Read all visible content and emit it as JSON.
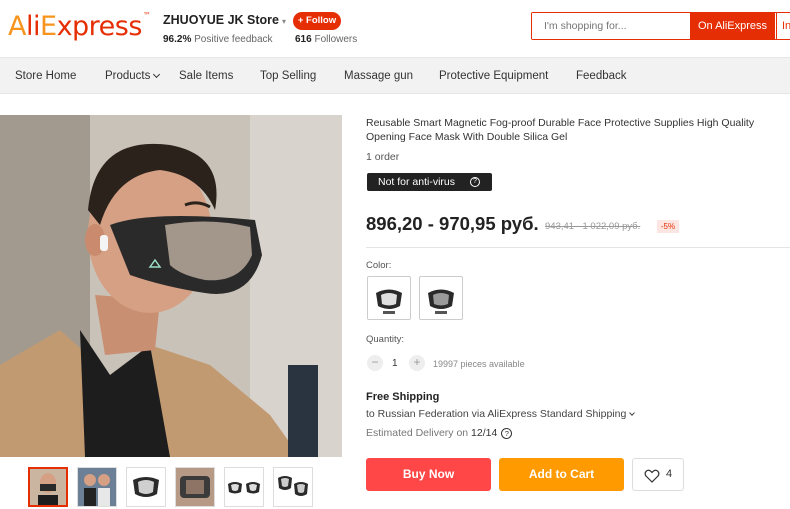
{
  "header": {
    "logo": "AliExpress",
    "store_name": "ZHUOYUE JK Store",
    "feedback_pct": "96.2%",
    "feedback_label": "Positive feedback",
    "follow_label": "+ Follow",
    "followers_count": "616",
    "followers_label": "Followers",
    "search_placeholder": "I'm shopping for...",
    "search_btn_ae": "On AliExpress",
    "search_btn_store": "In"
  },
  "nav": {
    "items": [
      "Store Home",
      "Products",
      "Sale Items",
      "Top Selling",
      "Massage gun",
      "Protective Equipment",
      "Feedback"
    ]
  },
  "product": {
    "title": "Reusable Smart Magnetic Fog-proof Durable Face Protective Supplies High Quality Opening Face Mask With Double Silica Gel",
    "orders": "1 order",
    "badge": "Not for anti-virus",
    "badge_icon": "?",
    "price": "896,20 - 970,95 руб.",
    "old_price": "943,41 - 1 022,09 руб.",
    "discount": "-5%",
    "color_label": "Color:",
    "quantity_label": "Quantity:",
    "qty_minus": "−",
    "qty_value": "1",
    "qty_plus": "+",
    "qty_available": "19997 pieces available",
    "shipping_title": "Free Shipping",
    "shipping_to": "to Russian Federation via AliExpress Standard Shipping",
    "delivery_label": "Estimated Delivery on",
    "delivery_date": "12/14",
    "delivery_icon": "?",
    "buy_now": "Buy Now",
    "add_to_cart": "Add to Cart",
    "wishlist_count": "4"
  },
  "colors": {
    "brand_red": "#e62e04",
    "buy_red": "#ff4747",
    "cart_orange": "#ff9a00"
  },
  "icons": {
    "wishlist": "heart-icon",
    "dropdown": "chevron-down-icon",
    "info": "question-circle-icon"
  }
}
